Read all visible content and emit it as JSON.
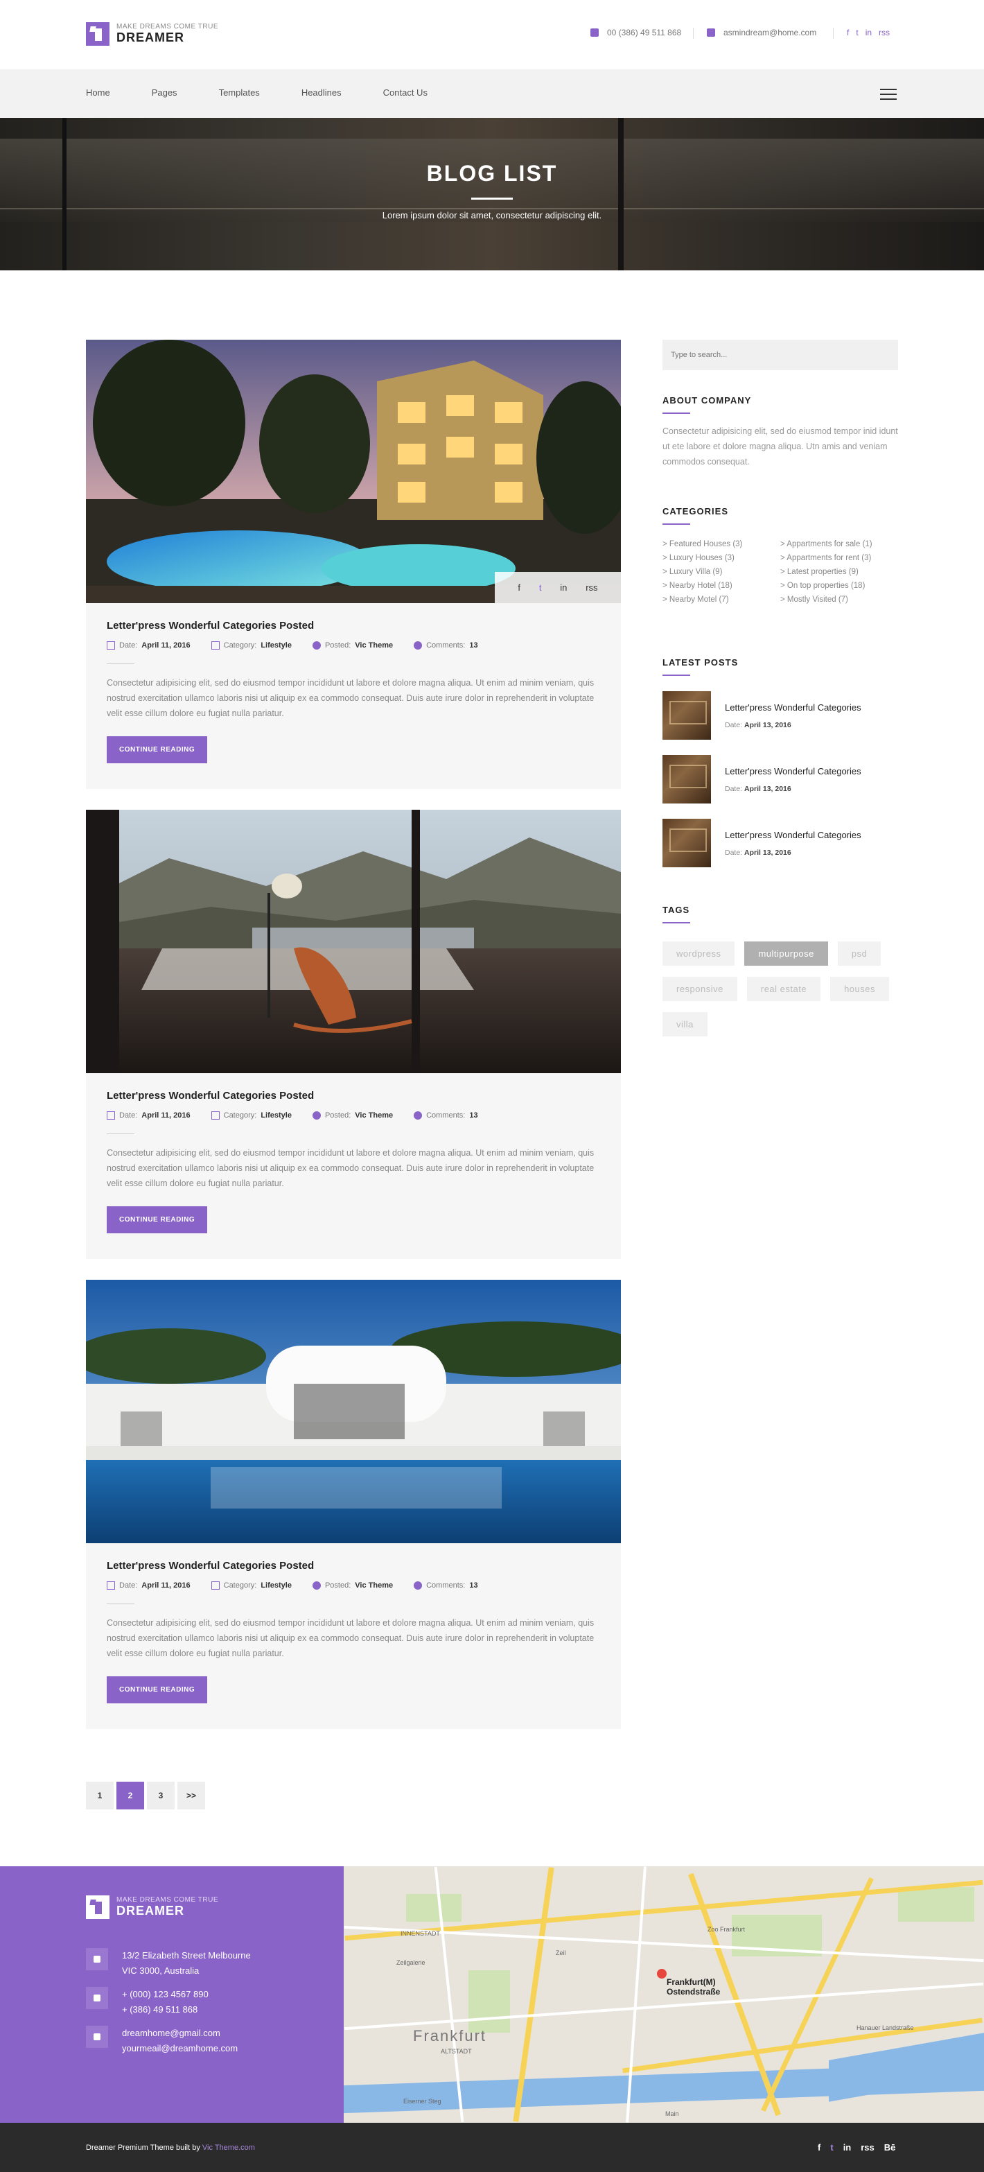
{
  "brand": {
    "tagline": "MAKE DREAMS COME TRUE",
    "name": "DREAMER"
  },
  "header": {
    "phone": "00 (386) 49 511 868",
    "email": "asmindream@home.com",
    "social": [
      "f",
      "t",
      "in",
      "rss"
    ]
  },
  "nav": {
    "items": [
      "Home",
      "Pages",
      "Templates",
      "Headlines",
      "Contact Us"
    ]
  },
  "hero": {
    "title": "BLOG LIST",
    "subtitle": "Lorem ipsum dolor sit amet, consectetur adipiscing elit."
  },
  "posts": [
    {
      "title": "Letter'press Wonderful Categories Posted",
      "date_label": "Date:",
      "date": "April 11, 2016",
      "category_label": "Category:",
      "category": "Lifestyle",
      "posted_label": "Posted:",
      "author": "Vic Theme",
      "comments_label": "Comments:",
      "comments": "13",
      "excerpt": "Consectetur adipisicing elit, sed do eiusmod tempor incididunt ut labore et dolore magna aliqua. Ut enim ad minim veniam, quis nostrud exercitation ullamco laboris nisi ut aliquip ex ea commodo consequat. Duis aute irure dolor in reprehenderit in voluptate velit esse cillum dolore eu fugiat nulla pariatur.",
      "button": "CONTINUE READING",
      "share": [
        "f",
        "t",
        "in",
        "rss"
      ]
    },
    {
      "title": "Letter'press Wonderful Categories Posted",
      "date_label": "Date:",
      "date": "April 11, 2016",
      "category_label": "Category:",
      "category": "Lifestyle",
      "posted_label": "Posted:",
      "author": "Vic Theme",
      "comments_label": "Comments:",
      "comments": "13",
      "excerpt": "Consectetur adipisicing elit, sed do eiusmod tempor incididunt ut labore et dolore magna aliqua. Ut enim ad minim veniam, quis nostrud exercitation ullamco laboris nisi ut aliquip ex ea commodo consequat. Duis aute irure dolor in reprehenderit in voluptate velit esse cillum dolore eu fugiat nulla pariatur.",
      "button": "CONTINUE READING"
    },
    {
      "title": "Letter'press Wonderful Categories Posted",
      "date_label": "Date:",
      "date": "April 11, 2016",
      "category_label": "Category:",
      "category": "Lifestyle",
      "posted_label": "Posted:",
      "author": "Vic Theme",
      "comments_label": "Comments:",
      "comments": "13",
      "excerpt": "Consectetur adipisicing elit, sed do eiusmod tempor incididunt ut labore et dolore magna aliqua. Ut enim ad minim veniam, quis nostrud exercitation ullamco laboris nisi ut aliquip ex ea commodo consequat. Duis aute irure dolor in reprehenderit in voluptate velit esse cillum dolore eu fugiat nulla pariatur.",
      "button": "CONTINUE READING"
    }
  ],
  "sidebar": {
    "search_placeholder": "Type to search...",
    "about": {
      "title": "ABOUT COMPANY",
      "text": "Consectetur adipisicing elit, sed do eiusmod tempor inid idunt ut ete labore et dolore magna aliqua. Utn amis and veniam commodos consequat."
    },
    "categories": {
      "title": "CATEGORIES",
      "items": [
        "> Featured Houses (3)",
        "> Appartments for sale (1)",
        "> Luxury Houses (3)",
        "> Appartments  for rent (3)",
        "> Luxury Villa (9)",
        "> Latest properties (9)",
        "> Nearby Hotel (18)",
        "> On top properties (18)",
        "> Nearby Motel (7)",
        "> Mostly Visited (7)"
      ]
    },
    "latest": {
      "title": "LATEST POSTS",
      "date_label": "Date:",
      "items": [
        {
          "title": "Letter'press Wonderful Categories",
          "date": "April 13, 2016"
        },
        {
          "title": "Letter'press Wonderful Categories",
          "date": "April 13, 2016"
        },
        {
          "title": "Letter'press Wonderful Categories",
          "date": "April 13, 2016"
        }
      ]
    },
    "tags": {
      "title": "TAGS",
      "items": [
        "wordpress",
        "multipurpose",
        "psd",
        "responsive",
        "real estate",
        "houses",
        "villa"
      ],
      "active": "multipurpose"
    }
  },
  "pagination": {
    "pages": [
      "1",
      "2",
      "3",
      ">>"
    ],
    "current": "2"
  },
  "footer": {
    "address": [
      "13/2 Elizabeth Street Melbourne",
      "VIC 3000, Australia"
    ],
    "phones": [
      "+ (000) 123 4567 890",
      "+ (386) 49 511 868"
    ],
    "emails": [
      "dreamhome@gmail.com",
      "yourmeail@dreamhome.com"
    ],
    "map": {
      "city": "Frankfurt",
      "marker": [
        "Frankfurt(M)",
        "Ostendstraße"
      ],
      "labels": [
        "INNENSTADT",
        "ALTSTADT",
        "Zoo Frankfurt",
        "Zeil",
        "Zeilgalerie",
        "Hanauer Landstraße",
        "Eiserner Steg",
        "Main"
      ]
    },
    "copyright_prefix": "Dreamer Premium Theme built by ",
    "copyright_link": "Vic Theme.com",
    "social": [
      "f",
      "t",
      "in",
      "rss",
      "Bē"
    ]
  },
  "colors": {
    "accent": "#8a63c8",
    "dark": "#2b2b2b",
    "light_bg": "#f6f6f6"
  }
}
